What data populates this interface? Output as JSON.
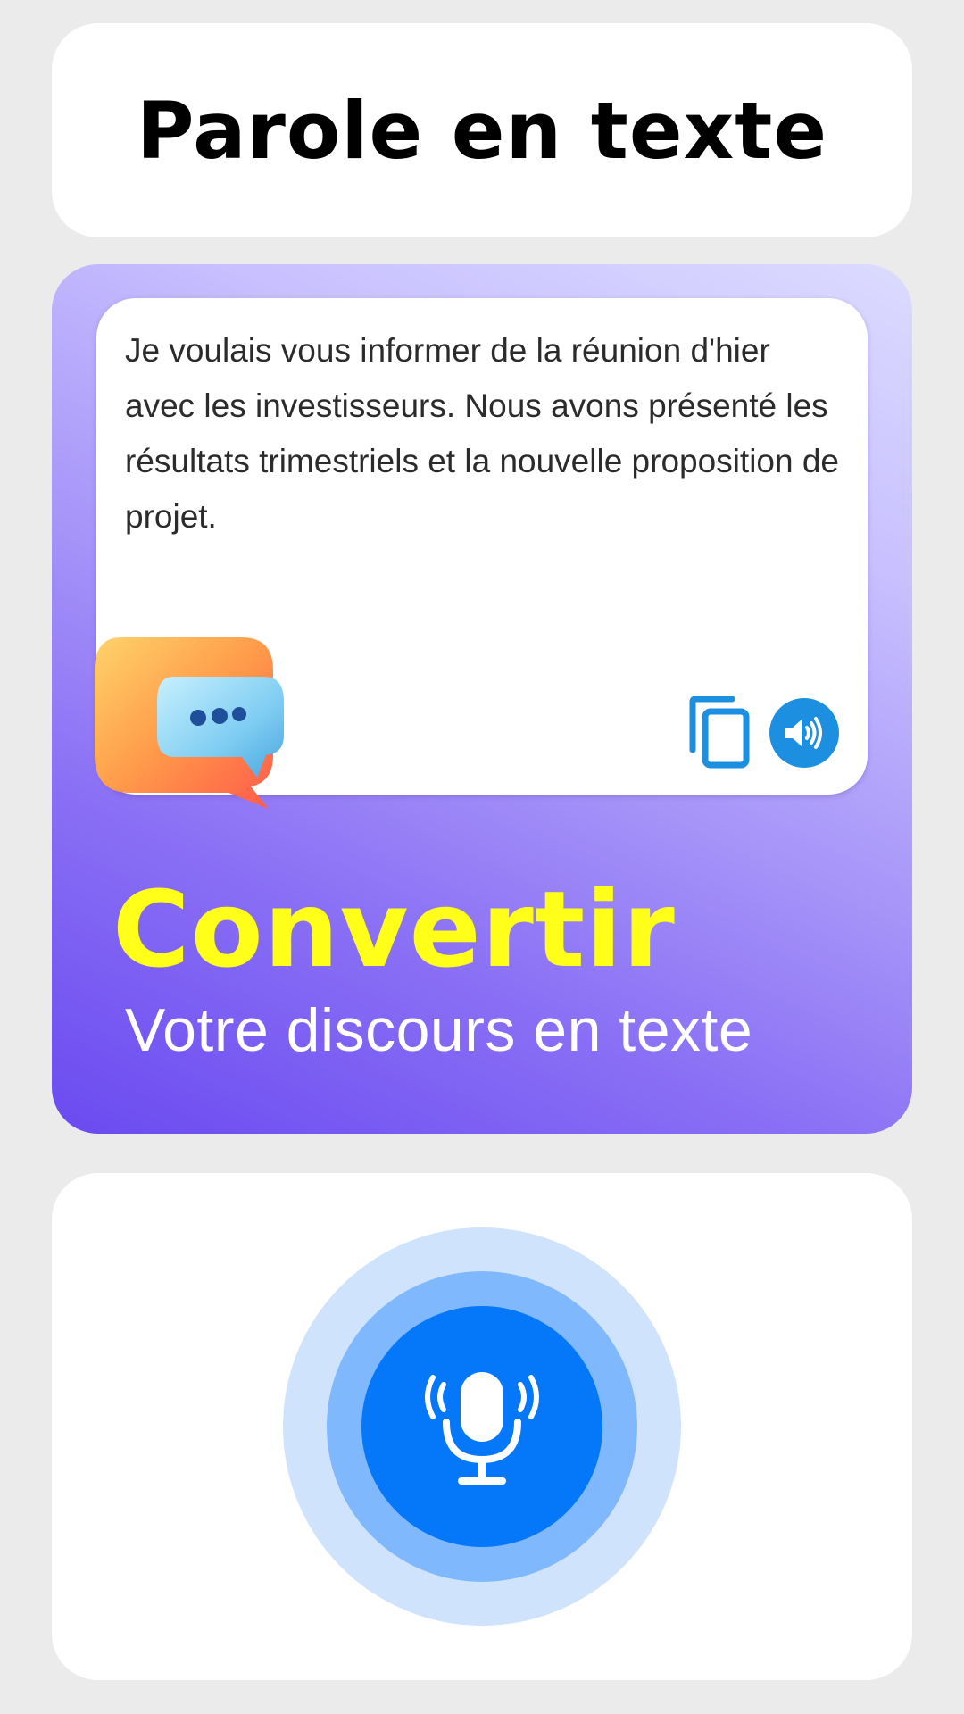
{
  "header": {
    "title": "Parole en texte"
  },
  "promo": {
    "transcript": "Je voulais vous informer de la réunion d'hier avec les investisseurs. Nous avons présenté les résultats trimestriels et la nouvelle proposition de projet.",
    "heading": "Convertir",
    "subheading": "Votre discours en texte",
    "icons": {
      "copy": "copy-icon",
      "speaker": "speaker-icon",
      "illustration": "chat-bubble-illustration"
    }
  },
  "mic": {
    "icon": "microphone-icon"
  },
  "colors": {
    "background": "#ebebeb",
    "heading_accent": "#ffff1a",
    "icon_blue": "#1d8fe1",
    "mic_blue": "#0478f9",
    "mic_ring_light": "#cfe3fd",
    "mic_ring_mid": "#80b8fd",
    "gradient_start": "#dcdbff",
    "gradient_end": "#6a4af0"
  }
}
